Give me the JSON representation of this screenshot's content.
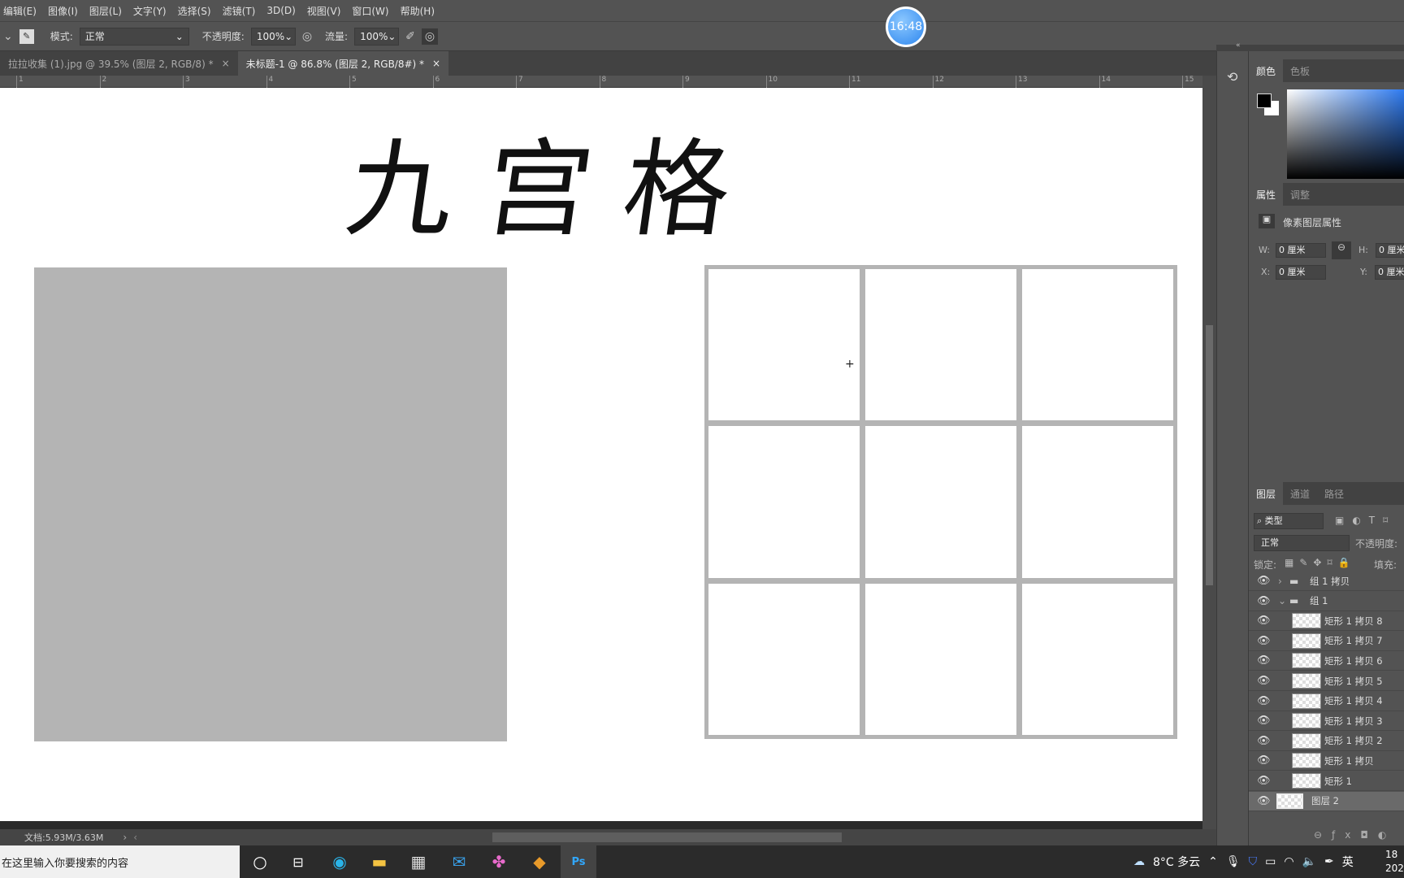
{
  "menu": [
    "编辑(E)",
    "图像(I)",
    "图层(L)",
    "文字(Y)",
    "选择(S)",
    "滤镜(T)",
    "3D(D)",
    "视图(V)",
    "窗口(W)",
    "帮助(H)"
  ],
  "options": {
    "mode_label": "模式:",
    "mode_value": "正常",
    "opacity_label": "不透明度:",
    "opacity_value": "100%",
    "flow_label": "流量:",
    "flow_value": "100%"
  },
  "clock_bubble": "16:48",
  "tabs": [
    {
      "label": "拉拉收集 (1).jpg @ 39.5% (图层 2, RGB/8) *",
      "close": "×"
    },
    {
      "label": "未标题-1 @ 86.8% (图层 2, RGB/8#) *",
      "close": "×"
    }
  ],
  "ruler": [
    "1",
    "2",
    "3",
    "4",
    "5",
    "6",
    "7",
    "8",
    "9",
    "10",
    "11",
    "12",
    "13",
    "14",
    "15"
  ],
  "canvas": {
    "title": "九宫格"
  },
  "status": {
    "doc": "文档:5.93M/3.63M"
  },
  "color_panel": {
    "tabs": [
      "颜色",
      "色板"
    ],
    "accent": "#2f7bf0"
  },
  "properties": {
    "tabs": [
      "属性",
      "调整"
    ],
    "title": "像素图层属性",
    "w_label": "W:",
    "w": "0 厘米",
    "h_label": "H:",
    "h": "0 厘米",
    "x_label": "X:",
    "x": "0 厘米",
    "y_label": "Y:",
    "y": "0 厘米"
  },
  "layers": {
    "tabs": [
      "图层",
      "通道",
      "路径"
    ],
    "filter": "类型",
    "blend": "正常",
    "opacity_label": "不透明度:",
    "lock_label": "锁定:",
    "fill_label": "填充:",
    "items": [
      {
        "name": "组 1 拷贝",
        "type": "group",
        "collapsed": true
      },
      {
        "name": "组 1",
        "type": "group",
        "collapsed": false
      },
      {
        "name": "矩形 1 拷贝 8",
        "type": "shape"
      },
      {
        "name": "矩形 1 拷贝 7",
        "type": "shape"
      },
      {
        "name": "矩形 1 拷贝 6",
        "type": "shape"
      },
      {
        "name": "矩形 1 拷贝 5",
        "type": "shape"
      },
      {
        "name": "矩形 1 拷贝 4",
        "type": "shape"
      },
      {
        "name": "矩形 1 拷贝 3",
        "type": "shape"
      },
      {
        "name": "矩形 1 拷贝 2",
        "type": "shape"
      },
      {
        "name": "矩形 1 拷贝",
        "type": "shape"
      },
      {
        "name": "矩形 1",
        "type": "shape"
      },
      {
        "name": "图层 2",
        "type": "pixel",
        "selected": true
      }
    ]
  },
  "taskbar": {
    "search_placeholder": "在这里输入你要搜索的内容",
    "weather": "8°C 多云",
    "ime": "英",
    "time": "18",
    "date": "202"
  }
}
